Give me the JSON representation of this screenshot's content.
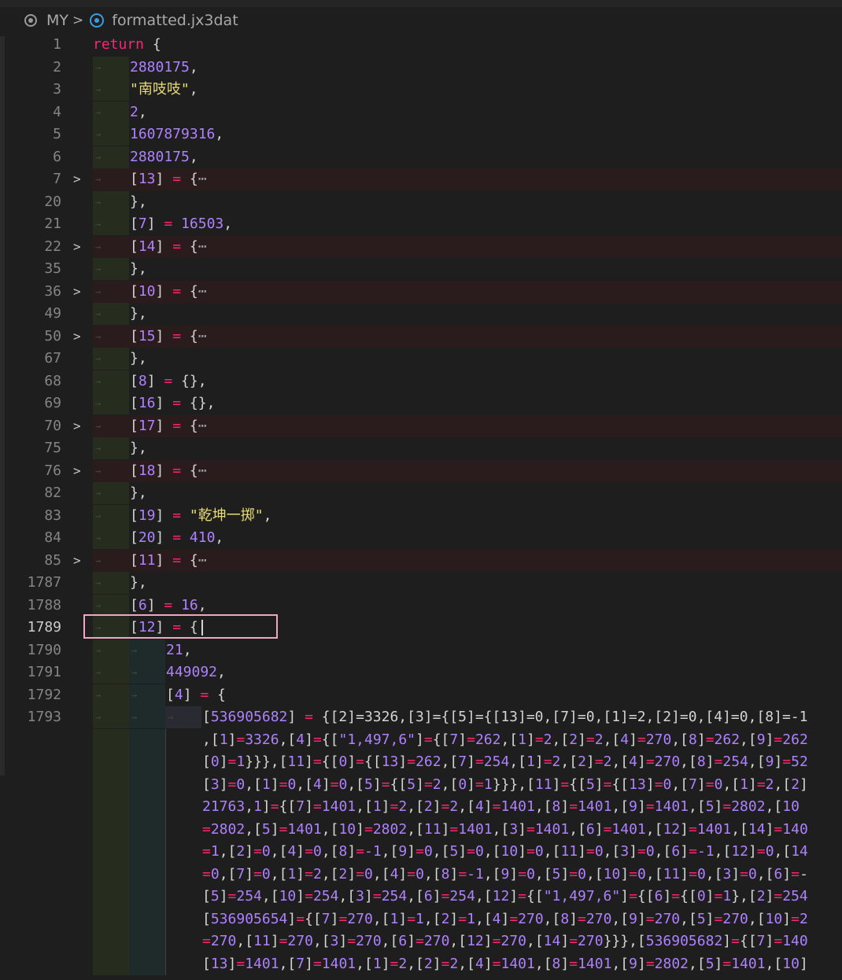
{
  "breadcrumb": {
    "folder": "MY",
    "file": "formatted.jx3dat"
  },
  "lines": [
    {
      "n": "1",
      "tokens": [
        [
          "kw",
          "return"
        ],
        [
          "pun",
          " {"
        ]
      ]
    },
    {
      "n": "2",
      "tokens": [
        [
          "num",
          "2880175"
        ],
        [
          "pun",
          ","
        ]
      ]
    },
    {
      "n": "3",
      "tokens": [
        [
          "str",
          "\"南吱吱\""
        ],
        [
          "pun",
          ","
        ]
      ]
    },
    {
      "n": "4",
      "tokens": [
        [
          "num",
          "2"
        ],
        [
          "pun",
          ","
        ]
      ]
    },
    {
      "n": "5",
      "tokens": [
        [
          "num",
          "1607879316"
        ],
        [
          "pun",
          ","
        ]
      ]
    },
    {
      "n": "6",
      "tokens": [
        [
          "num",
          "2880175"
        ],
        [
          "pun",
          ","
        ]
      ]
    },
    {
      "n": "7",
      "fold": true,
      "tokens": [
        [
          "pun",
          "["
        ],
        [
          "key",
          "13"
        ],
        [
          "pun",
          "] "
        ],
        [
          "op",
          "="
        ],
        [
          "pun",
          " {"
        ],
        [
          "fold",
          "⋯"
        ]
      ]
    },
    {
      "n": "20",
      "tokens": [
        [
          "pun",
          "},"
        ]
      ]
    },
    {
      "n": "21",
      "tokens": [
        [
          "pun",
          "["
        ],
        [
          "key",
          "7"
        ],
        [
          "pun",
          "] "
        ],
        [
          "op",
          "="
        ],
        [
          "pun",
          " "
        ],
        [
          "num",
          "16503"
        ],
        [
          "pun",
          ","
        ]
      ]
    },
    {
      "n": "22",
      "fold": true,
      "tokens": [
        [
          "pun",
          "["
        ],
        [
          "key",
          "14"
        ],
        [
          "pun",
          "] "
        ],
        [
          "op",
          "="
        ],
        [
          "pun",
          " {"
        ],
        [
          "fold",
          "⋯"
        ]
      ]
    },
    {
      "n": "35",
      "tokens": [
        [
          "pun",
          "},"
        ]
      ]
    },
    {
      "n": "36",
      "fold": true,
      "tokens": [
        [
          "pun",
          "["
        ],
        [
          "key",
          "10"
        ],
        [
          "pun",
          "] "
        ],
        [
          "op",
          "="
        ],
        [
          "pun",
          " {"
        ],
        [
          "fold",
          "⋯"
        ]
      ]
    },
    {
      "n": "49",
      "tokens": [
        [
          "pun",
          "},"
        ]
      ]
    },
    {
      "n": "50",
      "fold": true,
      "tokens": [
        [
          "pun",
          "["
        ],
        [
          "key",
          "15"
        ],
        [
          "pun",
          "] "
        ],
        [
          "op",
          "="
        ],
        [
          "pun",
          " {"
        ],
        [
          "fold",
          "⋯"
        ]
      ]
    },
    {
      "n": "67",
      "tokens": [
        [
          "pun",
          "},"
        ]
      ]
    },
    {
      "n": "68",
      "tokens": [
        [
          "pun",
          "["
        ],
        [
          "key",
          "8"
        ],
        [
          "pun",
          "] "
        ],
        [
          "op",
          "="
        ],
        [
          "pun",
          " {},"
        ]
      ]
    },
    {
      "n": "69",
      "tokens": [
        [
          "pun",
          "["
        ],
        [
          "key",
          "16"
        ],
        [
          "pun",
          "] "
        ],
        [
          "op",
          "="
        ],
        [
          "pun",
          " {},"
        ]
      ]
    },
    {
      "n": "70",
      "fold": true,
      "tokens": [
        [
          "pun",
          "["
        ],
        [
          "key",
          "17"
        ],
        [
          "pun",
          "] "
        ],
        [
          "op",
          "="
        ],
        [
          "pun",
          " {"
        ],
        [
          "fold",
          "⋯"
        ]
      ]
    },
    {
      "n": "75",
      "tokens": [
        [
          "pun",
          "},"
        ]
      ]
    },
    {
      "n": "76",
      "fold": true,
      "tokens": [
        [
          "pun",
          "["
        ],
        [
          "key",
          "18"
        ],
        [
          "pun",
          "] "
        ],
        [
          "op",
          "="
        ],
        [
          "pun",
          " {"
        ],
        [
          "fold",
          "⋯"
        ]
      ]
    },
    {
      "n": "82",
      "tokens": [
        [
          "pun",
          "},"
        ]
      ]
    },
    {
      "n": "83",
      "tokens": [
        [
          "pun",
          "["
        ],
        [
          "key",
          "19"
        ],
        [
          "pun",
          "] "
        ],
        [
          "op",
          "="
        ],
        [
          "pun",
          " "
        ],
        [
          "str",
          "\"乾坤一掷\""
        ],
        [
          "pun",
          ","
        ]
      ]
    },
    {
      "n": "84",
      "tokens": [
        [
          "pun",
          "["
        ],
        [
          "key",
          "20"
        ],
        [
          "pun",
          "] "
        ],
        [
          "op",
          "="
        ],
        [
          "pun",
          " "
        ],
        [
          "num",
          "410"
        ],
        [
          "pun",
          ","
        ]
      ]
    },
    {
      "n": "85",
      "fold": true,
      "tokens": [
        [
          "pun",
          "["
        ],
        [
          "key",
          "11"
        ],
        [
          "pun",
          "] "
        ],
        [
          "op",
          "="
        ],
        [
          "pun",
          " {"
        ],
        [
          "fold",
          "⋯"
        ]
      ]
    },
    {
      "n": "1787",
      "tokens": [
        [
          "pun",
          "},"
        ]
      ]
    },
    {
      "n": "1788",
      "tokens": [
        [
          "pun",
          "["
        ],
        [
          "key",
          "6"
        ],
        [
          "pun",
          "] "
        ],
        [
          "op",
          "="
        ],
        [
          "pun",
          " "
        ],
        [
          "num",
          "16"
        ],
        [
          "pun",
          ","
        ]
      ]
    },
    {
      "n": "1789",
      "active": true,
      "tokens": [
        [
          "pun",
          "["
        ],
        [
          "key",
          "12"
        ],
        [
          "pun",
          "] "
        ],
        [
          "op",
          "="
        ],
        [
          "pun",
          " {"
        ]
      ]
    },
    {
      "n": "1790",
      "tokens": [
        [
          "num",
          "21"
        ],
        [
          "pun",
          ","
        ]
      ]
    },
    {
      "n": "1791",
      "tokens": [
        [
          "num",
          "449092"
        ],
        [
          "pun",
          ","
        ]
      ]
    },
    {
      "n": "1792",
      "tokens": [
        [
          "pun",
          "["
        ],
        [
          "key",
          "4"
        ],
        [
          "pun",
          "] "
        ],
        [
          "op",
          "="
        ],
        [
          "pun",
          " {"
        ]
      ]
    },
    {
      "n": "1793",
      "tokens": [
        [
          "pun",
          "["
        ],
        [
          "key",
          "536905682"
        ],
        [
          "pun",
          "] "
        ],
        [
          "op",
          "="
        ],
        [
          "pun",
          " {[2]=3326,[3]={[5]={[13]=0,[7]=0,[1]=2,[2]=0,[4]=0,[8]=-1"
        ]
      ]
    }
  ],
  "wrapped": [
    ",[1]=3326,[4]={[\"1,497,6\"]={[7]=262,[1]=2,[2]=2,[4]=270,[8]=262,[9]=262",
    "[0]=1}}},[11]={[0]={[13]=262,[7]=254,[1]=2,[2]=2,[4]=270,[8]=254,[9]=52",
    "[3]=0,[1]=0,[4]=0,[5]={[5]=2,[0]=1}}},[11]={[5]={[13]=0,[7]=0,[1]=2,[2]",
    "21763,1\"]={[7]=1401,[1]=2,[2]=2,[4]=1401,[8]=1401,[9]=1401,[5]=2802,[10",
    "=2802,[5]=1401,[10]=2802,[11]=1401,[3]=1401,[6]=1401,[12]=1401,[14]=140",
    "=1,[2]=0,[4]=0,[8]=-1,[9]=0,[5]=0,[10]=0,[11]=0,[3]=0,[6]=-1,[12]=0,[14",
    "=0,[7]=0,[1]=2,[2]=0,[4]=0,[8]=-1,[9]=0,[5]=0,[10]=0,[11]=0,[3]=0,[6]=-",
    "[5]=254,[10]=254,[3]=254,[6]=254,[12]={[\"1,497,6\"]={[6]={[0]=1},[2]=254",
    "[536905654]={[7]=270,[1]=1,[2]=1,[4]=270,[8]=270,[9]=270,[5]=270,[10]=2",
    "=270,[11]=270,[3]=270,[6]=270,[12]=270,[14]=270}}},[536905682]={[7]=140",
    "[13]=1401,[7]=1401,[1]=2,[2]=2,[4]=1401,[8]=1401,[9]=2802,[5]=1401,[10]"
  ],
  "icons": {
    "folder_icon": "circle-dot-icon",
    "file_icon": "jx3dat-file-icon",
    "fold_icon": "chevron-right-icon"
  },
  "colors": {
    "background": "#1e1e1e",
    "keyword": "#f92672",
    "number": "#ae81ff",
    "string": "#e6db74",
    "cursor_box": "#f0a5c0"
  }
}
